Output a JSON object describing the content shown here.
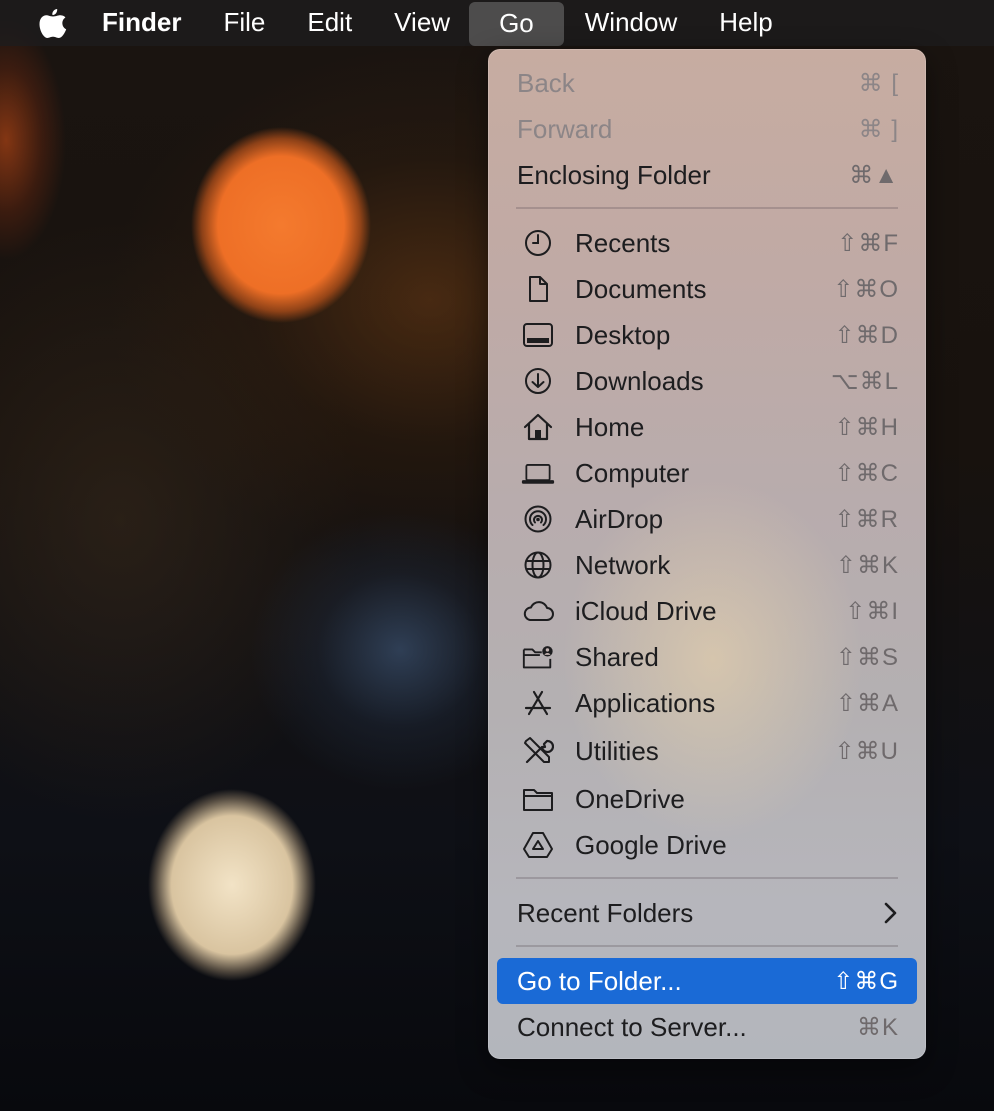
{
  "menubar": {
    "apple_icon": "apple-logo-icon",
    "app_name": "Finder",
    "menus": [
      "File",
      "Edit",
      "View",
      "Go",
      "Window",
      "Help"
    ],
    "active_menu": "Go"
  },
  "go_menu": {
    "nav": [
      {
        "label": "Back",
        "shortcut": "⌘ [",
        "enabled": false
      },
      {
        "label": "Forward",
        "shortcut": "⌘ ]",
        "enabled": false
      },
      {
        "label": "Enclosing Folder",
        "shortcut": "⌘▲",
        "enabled": true
      }
    ],
    "places": [
      {
        "label": "Recents",
        "shortcut": "⇧⌘F",
        "icon": "clock-icon"
      },
      {
        "label": "Documents",
        "shortcut": "⇧⌘O",
        "icon": "document-icon"
      },
      {
        "label": "Desktop",
        "shortcut": "⇧⌘D",
        "icon": "desktop-icon"
      },
      {
        "label": "Downloads",
        "shortcut": "⌥⌘L",
        "icon": "download-icon"
      },
      {
        "label": "Home",
        "shortcut": "⇧⌘H",
        "icon": "house-icon"
      },
      {
        "label": "Computer",
        "shortcut": "⇧⌘C",
        "icon": "laptop-icon"
      },
      {
        "label": "AirDrop",
        "shortcut": "⇧⌘R",
        "icon": "airdrop-icon"
      },
      {
        "label": "Network",
        "shortcut": "⇧⌘K",
        "icon": "globe-icon"
      },
      {
        "label": "iCloud Drive",
        "shortcut": "⇧⌘I",
        "icon": "cloud-icon"
      },
      {
        "label": "Shared",
        "shortcut": "⇧⌘S",
        "icon": "shared-folder-icon"
      },
      {
        "label": "Applications",
        "shortcut": "⇧⌘A",
        "icon": "applications-icon"
      },
      {
        "label": "Utilities",
        "shortcut": "⇧⌘U",
        "icon": "utilities-icon"
      },
      {
        "label": "OneDrive",
        "shortcut": "",
        "icon": "folder-icon"
      },
      {
        "label": "Google Drive",
        "shortcut": "",
        "icon": "google-drive-icon"
      }
    ],
    "recent_folders": {
      "label": "Recent Folders",
      "icon": "chevron-right-icon"
    },
    "go_to_folder": {
      "label": "Go to Folder...",
      "shortcut": "⇧⌘G",
      "highlighted": true
    },
    "connect_to_server": {
      "label": "Connect to Server...",
      "shortcut": "⌘K"
    },
    "colors": {
      "highlight": "#1a6ad6",
      "text": "#1d1d1f",
      "disabled": "#8c8587"
    }
  }
}
